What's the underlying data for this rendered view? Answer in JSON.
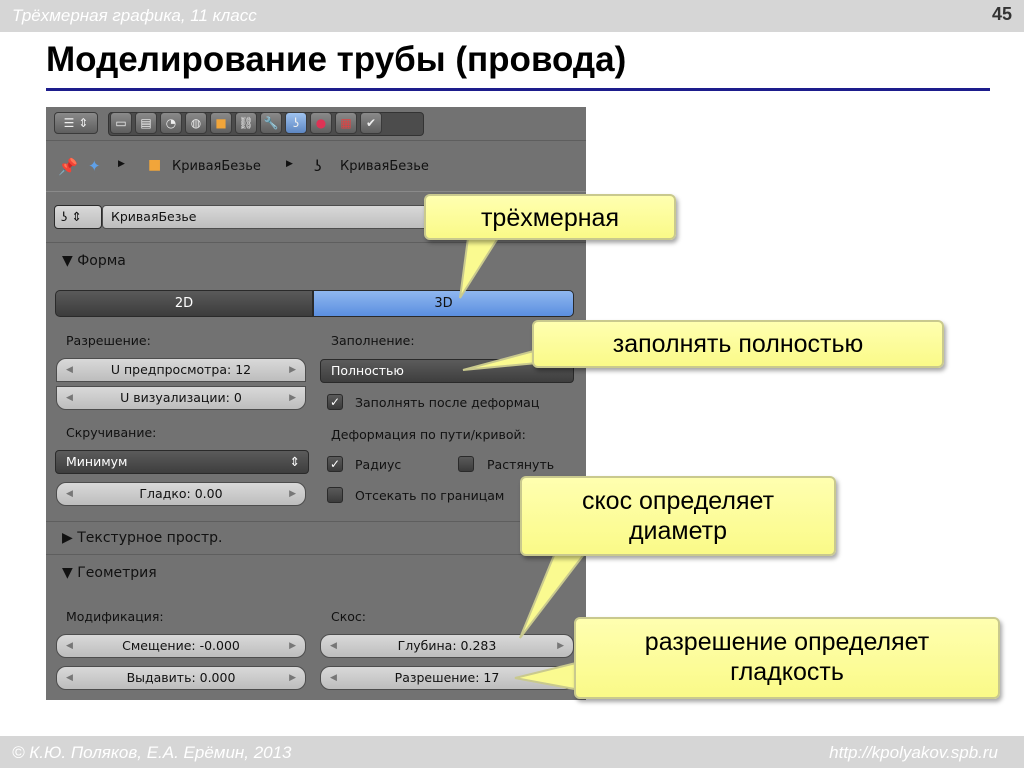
{
  "slide": {
    "course": "Трёхмерная графика, 11 класс",
    "page_number": "45",
    "title": "Моделирование трубы (провода)",
    "authors": "© К.Ю. Поляков, Е.А. Ерёмин, 2013",
    "url": "http://kpolyakov.spb.ru"
  },
  "panel": {
    "breadcrumb": {
      "object": "КриваяБезье",
      "data": "КриваяБезье"
    },
    "datablock_name": "КриваяБезье",
    "shape_section": {
      "header": "Форма",
      "toggle_2d": "2D",
      "toggle_3d": "3D",
      "resolution_label": "Разрешение:",
      "preview_u": "U предпросмотра: 12",
      "render_u": "U визуализации: 0",
      "fill_label": "Заполнение:",
      "fill_value": "Полностью",
      "fill_deformed": "Заполнять после деформац",
      "twist_label": "Скручивание:",
      "twist_value": "Минимум",
      "smooth": "Гладко: 0.00",
      "path_deform_label": "Деформация по пути/кривой:",
      "radius": "Радиус",
      "stretch": "Растянуть",
      "bounds_clamp": "Отсекать по границам"
    },
    "texture_section": {
      "header": "Текстурное простр."
    },
    "geometry_section": {
      "header": "Геометрия",
      "modification_label": "Модификация:",
      "offset": "Смещение: -0.000",
      "extrude": "Выдавить: 0.000",
      "bevel_label": "Скос:",
      "depth": "Глубина: 0.283",
      "resolution": "Разрешение: 17"
    }
  },
  "callouts": {
    "three_d": "трёхмерная",
    "fill_full": "заполнять полностью",
    "bevel_line1": "скос определяет",
    "bevel_line2": "диаметр",
    "res_line1": "разрешение определяет",
    "res_line2": "гладкость"
  },
  "colors": {
    "callout_fill": "#fafa90",
    "panel_bg": "#727272",
    "active_toggle": "#6f9fe8",
    "title_rule": "#1d1d8c"
  }
}
